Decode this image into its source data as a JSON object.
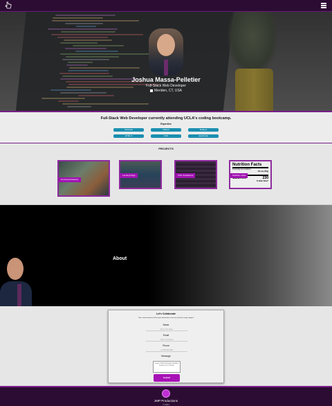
{
  "nav": {
    "logo_icon": "hand-cursor-icon",
    "menu_icon": "hamburger-menu-icon"
  },
  "hero": {
    "name": "Joshua Massa-Pelletier",
    "role": "Full-Stack Web Developer",
    "location": "Meriden, CT, USA"
  },
  "skills": {
    "tagline": "Full-Stack Web Developer currently attending UCLA's coding bootcamp.",
    "heading": "Expertise",
    "items": [
      "Git/Code",
      "GitHub",
      "Node.js",
      "HTML 5",
      "CSS",
      "JavaScript"
    ]
  },
  "projects": {
    "title": "PROJECTS",
    "items": [
      {
        "label": "Horizontal Refactor"
      },
      {
        "label": "Landing Page"
      },
      {
        "label": "CSS Cheatsheet"
      },
      {
        "label": "Nutrition Label"
      }
    ],
    "nutrition": {
      "title": "Nutrition Facts",
      "servings": "8 servings per container",
      "serving_size": "2/3 cup (55g)",
      "calories_label": "Calories",
      "calories_value": "230",
      "daily_value": "% Daily Value*"
    }
  },
  "about": {
    "title": "About"
  },
  "contact": {
    "title": "Let's Collaborate",
    "subtitle": "Take a brief moment to fill out your information so we can make this magic happen!",
    "name_label": "Name",
    "name_placeholder": "Enter Your Name",
    "email_label": "Email",
    "email_placeholder": "Enter Your Email",
    "phone_label": "Phone",
    "phone_placeholder": "+1 000-000-0000",
    "message_label": "Message",
    "message_placeholder": "Leave A Brief Message Detailing Reason For Contact",
    "submit_label": "Submit"
  },
  "footer": {
    "brand": "JMP Productions",
    "copy": "© 2021"
  },
  "colors": {
    "accent": "#a212b3",
    "nav": "#2c0c33",
    "pill": "#1a8fb0"
  }
}
